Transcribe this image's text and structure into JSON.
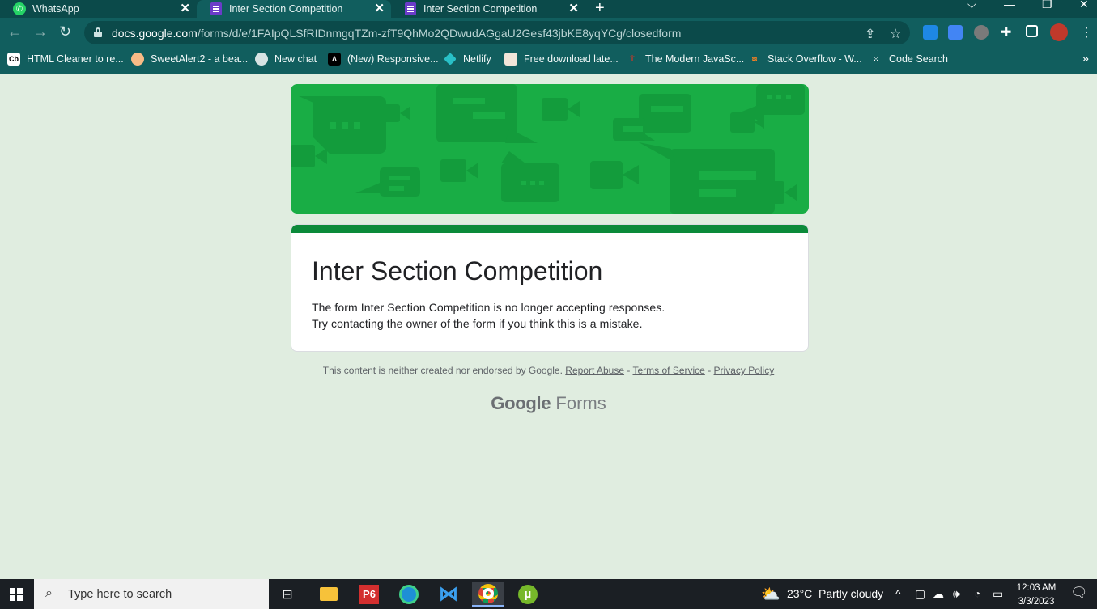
{
  "browser": {
    "tabs": [
      {
        "title": "WhatsApp",
        "icon": "whatsapp-icon",
        "active": false
      },
      {
        "title": "Inter Section Competition",
        "icon": "google-forms-icon",
        "active": true
      },
      {
        "title": "Inter Section Competition",
        "icon": "google-forms-icon",
        "active": false
      }
    ],
    "url_host": "docs.google.com",
    "url_path": "/forms/d/e/1FAIpQLSfRIDnmgqTZm-zfT9QhMo2QDwudAGgaU2Gesf43jbKE8yqYCg/closedform",
    "bookmarks": [
      {
        "label": "HTML Cleaner to re...",
        "icon": "cb-icon"
      },
      {
        "label": "SweetAlert2 - a bea...",
        "icon": "sweetalert-icon"
      },
      {
        "label": "New chat",
        "icon": "chatgpt-icon"
      },
      {
        "label": "(New) Responsive...",
        "icon": "responsive-icon"
      },
      {
        "label": "Netlify",
        "icon": "netlify-icon"
      },
      {
        "label": "Free download late...",
        "icon": "download-icon"
      },
      {
        "label": "The Modern JavaSc...",
        "icon": "javascript-info-icon"
      },
      {
        "label": "Stack Overflow - W...",
        "icon": "stackoverflow-icon"
      },
      {
        "label": "Code Search",
        "icon": "code-search-icon"
      }
    ]
  },
  "form": {
    "title": "Inter Section Competition",
    "message_line1": "The form Inter Section Competition is no longer accepting responses.",
    "message_line2": "Try contacting the owner of the form if you think this is a mistake.",
    "theme_color": "#0b8a3a",
    "header_color": "#19ad45"
  },
  "footer": {
    "disclaimer": "This content is neither created nor endorsed by Google.",
    "report_abuse": "Report Abuse",
    "terms": "Terms of Service",
    "privacy": "Privacy Policy",
    "sep": "-",
    "brand_google": "Google",
    "brand_forms": "Forms"
  },
  "taskbar": {
    "search_placeholder": "Type here to search",
    "weather_temp": "23°C",
    "weather_text": "Partly cloudy",
    "time": "12:03 AM",
    "date": "3/3/2023",
    "apps": [
      "task-view-icon",
      "file-explorer-icon",
      "p6-icon",
      "edge-icon",
      "vscode-icon",
      "chrome-icon",
      "utorrent-icon"
    ]
  }
}
